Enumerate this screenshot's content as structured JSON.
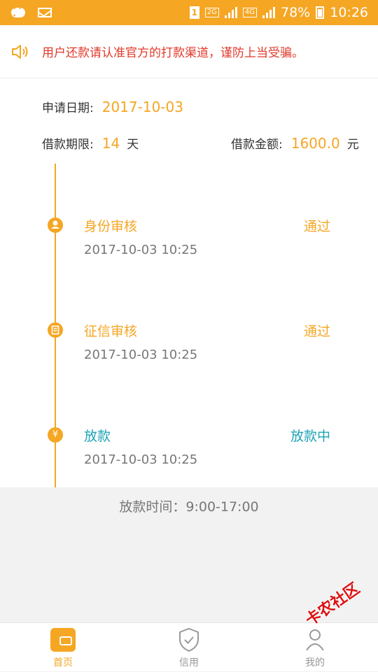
{
  "status_bar": {
    "sim": "1",
    "network_2g": "2G",
    "network_4g": "4G",
    "battery": "78%",
    "time": "10:26",
    "icons": [
      "chat-icon",
      "mail-icon",
      "signal-icon",
      "battery-icon"
    ]
  },
  "notice": {
    "icon": "speaker-icon",
    "text": "用户还款请认准官方的打款渠道，谨防上当受骗。"
  },
  "info": {
    "apply_date_label": "申请日期:",
    "apply_date": "2017-10-03",
    "term_label": "借款期限:",
    "term_value": "14",
    "term_unit": "天",
    "amount_label": "借款金额:",
    "amount_value": "1600.0",
    "amount_unit": "元"
  },
  "timeline": [
    {
      "icon": "person-icon",
      "title": "身份审核",
      "status": "通过",
      "time": "2017-10-03 10:25"
    },
    {
      "icon": "document-icon",
      "title": "征信审核",
      "status": "通过",
      "time": "2017-10-03 10:25"
    },
    {
      "icon": "yen-icon",
      "title": "放款",
      "status": "放款中",
      "time": "2017-10-03 10:25"
    }
  ],
  "loan_time": "放款时间：9:00-17:00",
  "tabs": [
    {
      "icon": "wallet-icon",
      "label": "首页"
    },
    {
      "icon": "shield-check-icon",
      "label": "信用"
    },
    {
      "icon": "user-icon",
      "label": "我的"
    }
  ],
  "watermark": "卡农社区",
  "colors": {
    "accent": "#f5a623",
    "warning": "#e0392a",
    "in_progress": "#1fa3b6"
  }
}
